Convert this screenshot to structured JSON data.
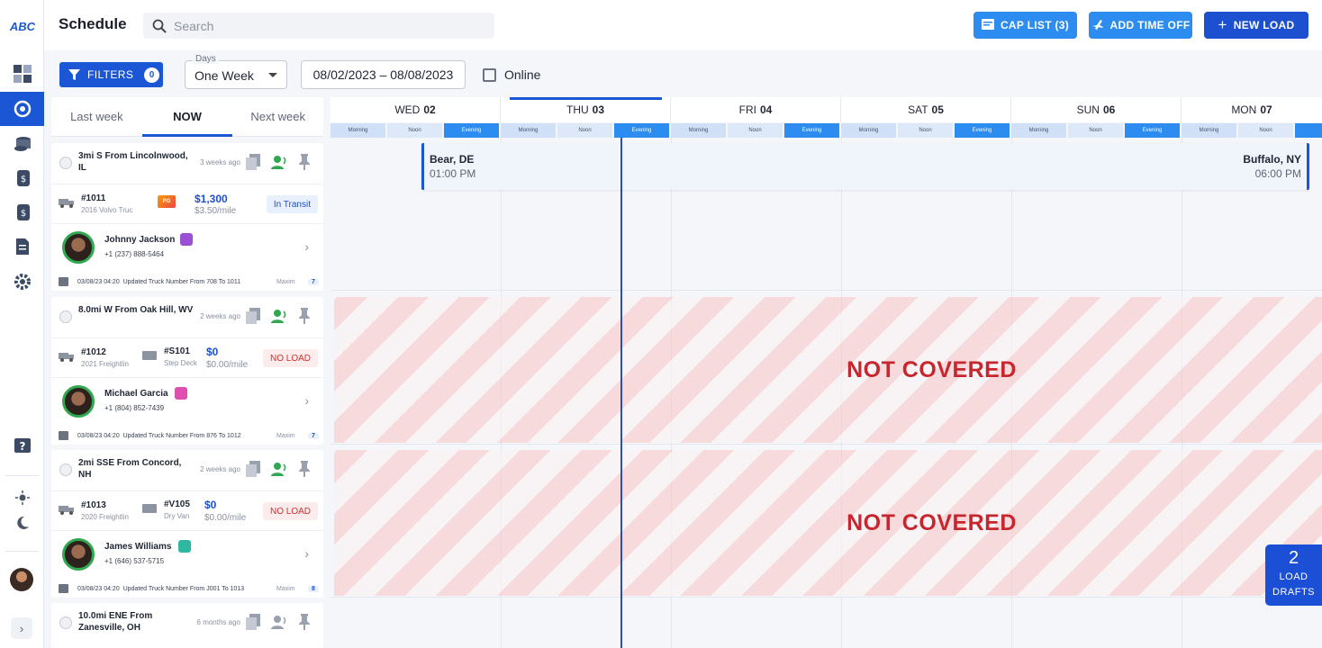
{
  "brand": {
    "logo_text": "ABC",
    "accent": "#1b57d4"
  },
  "nav": {
    "items": [
      "dashboard-icon",
      "support-icon",
      "coins-icon",
      "money-icon",
      "money-bag-icon",
      "document-icon",
      "settings-icon",
      "help-icon"
    ],
    "theme": [
      "sun-icon",
      "moon-icon"
    ]
  },
  "topbar": {
    "title": "Schedule",
    "search_placeholder": "Search",
    "cap_list": "CAP LIST (3)",
    "add_time_off": "ADD TIME OFF",
    "new_load": "NEW LOAD"
  },
  "toolbar": {
    "filters_label": "FILTERS",
    "filters_count": "0",
    "days_label": "Days",
    "days_value": "One Week",
    "date_range": "08/02/2023 – 08/08/2023",
    "online_label": "Online"
  },
  "week_tabs": [
    "Last week",
    "NOW",
    "Next week"
  ],
  "drivers": [
    {
      "location": "3mi S From Lincolnwood, IL",
      "ago": "3 weeks ago",
      "unit": "#1011",
      "unit_sub": "2016 Volvo Truc",
      "trailer": "",
      "trailer_sub": "",
      "price": "$1,300",
      "per_mile": "$3.50/mile",
      "status": "In Transit",
      "name": "Johnny Jackson",
      "phone": "+1 (237) 888-5464",
      "note_date": "03/08/23 04:20",
      "note": "Updated Truck Number From 708 To 1011",
      "author": "Maxim",
      "count": "7"
    },
    {
      "location": "8.0mi W From Oak Hill, WV",
      "ago": "2 weeks ago",
      "unit": "#1012",
      "unit_sub": "2021 Freightlin",
      "trailer": "#S101",
      "trailer_sub": "Step Deck",
      "price": "$0",
      "per_mile": "$0.00/mile",
      "status": "NO LOAD",
      "name": "Michael Garcia",
      "phone": "+1 (804) 852-7439",
      "note_date": "03/08/23 04:20",
      "note": "Updated Truck Number From 876 To 1012",
      "author": "Maxim",
      "count": "7"
    },
    {
      "location": "2mi SSE From Concord, NH",
      "ago": "2 weeks ago",
      "unit": "#1013",
      "unit_sub": "2020 Freightlin",
      "trailer": "#V105",
      "trailer_sub": "Dry Van",
      "price": "$0",
      "per_mile": "$0.00/mile",
      "status": "NO LOAD",
      "name": "James Williams",
      "phone": "+1 (646) 537-5715",
      "note_date": "03/08/23 04:20",
      "note": "Updated Truck Number From J001 To 1013",
      "author": "Maxim",
      "count": "8"
    },
    {
      "location": "10.0mi ENE From Zanesville, OH",
      "ago": "6 months ago"
    }
  ],
  "schedule": {
    "days": [
      {
        "dow": "WED",
        "num": "02"
      },
      {
        "dow": "THU",
        "num": "03"
      },
      {
        "dow": "FRI",
        "num": "04"
      },
      {
        "dow": "SAT",
        "num": "05"
      },
      {
        "dow": "SUN",
        "num": "06"
      },
      {
        "dow": "MON",
        "num": "07"
      }
    ],
    "slots": [
      "Morning",
      "Noon",
      "Evening"
    ],
    "trip": {
      "from": "Bear, DE",
      "from_time": "01:00 PM",
      "to": "Buffalo, NY",
      "to_time": "06:00 PM"
    },
    "not_covered": "NOT COVERED"
  },
  "drafts": {
    "count": "2",
    "label_line1": "LOAD",
    "label_line2": "DRAFTS"
  }
}
